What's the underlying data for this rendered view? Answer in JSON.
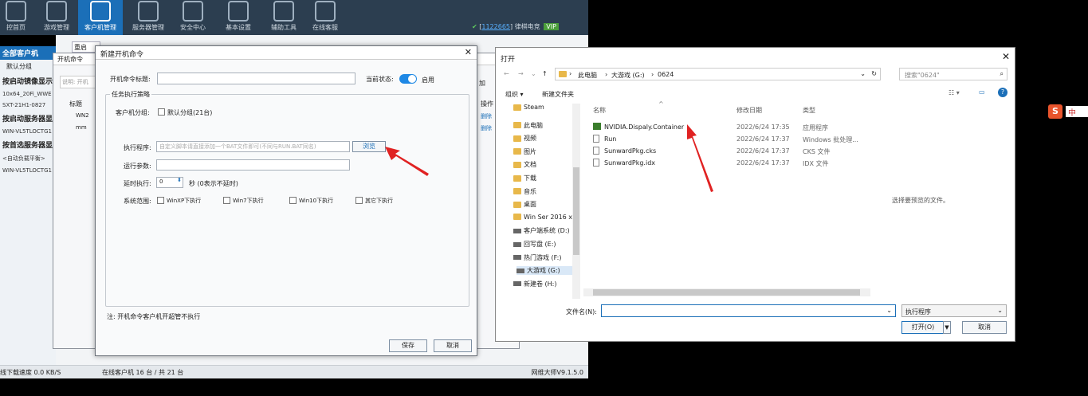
{
  "nav": {
    "items": [
      "控首页",
      "游戏管理",
      "客户机管理",
      "服务器管理",
      "安全中心",
      "基本设置",
      "辅助工具",
      "在线客服"
    ],
    "active_index": 2
  },
  "vip": {
    "id": "1122665",
    "name": "律棋电竞",
    "badge": "VIP"
  },
  "tree": {
    "header": "全部客户机",
    "items": [
      {
        "t": "默认分组",
        "k": "n"
      },
      {
        "t": "按启动镜像显示",
        "k": "b"
      },
      {
        "t": "10x64_20Fi_WWE",
        "k": "s"
      },
      {
        "t": "SXT-21H1-0827",
        "k": "s"
      },
      {
        "t": "按启动服务器显",
        "k": "b"
      },
      {
        "t": "WIN-VL5TLOCTG1",
        "k": "s"
      },
      {
        "t": "按首选服务器显",
        "k": "b"
      },
      {
        "t": "<自动负载平衡>",
        "k": "s"
      },
      {
        "t": "WIN-VL5TLOCTG1",
        "k": "s"
      }
    ]
  },
  "toolbar": {
    "restart": "重启"
  },
  "status": {
    "left": "线下载速度 0.0 KB/S",
    "mid": "在线客户机 16 台 / 共 21 台",
    "right": "网维大师V9.1.5.0"
  },
  "back_dialog": {
    "title": "开机命令",
    "hint": "说明: 开机",
    "col_title": "标题",
    "rows": [
      "WN2",
      "mm"
    ],
    "col_op": "操作",
    "op_delete": "删除",
    "add": "加"
  },
  "dialog": {
    "title": "新建开机命令",
    "title_label": "开机命令标题:",
    "state_label": "当前状态:",
    "state_value": "启用",
    "strategy": "任务执行策略",
    "group_label": "客户机分组:",
    "group_option": "默认分组(21台)",
    "program_label": "执行程序:",
    "program_placeholder": "自定义脚本请直接添加一个BAT文件即可(不同与RUN.BAT同名)",
    "browse": "浏览",
    "params_label": "运行参数:",
    "delay_label": "延时执行:",
    "delay_value": "0",
    "delay_unit": "秒 (0表示不延时)",
    "scope_label": "系统范围:",
    "scopes": [
      "WinXP下执行",
      "Win7下执行",
      "Win10下执行",
      "其它下执行"
    ],
    "note": "注: 开机命令客户机开超管不执行",
    "save": "保存",
    "cancel": "取消"
  },
  "file_dialog": {
    "title": "打开",
    "path": [
      "此电脑",
      "大游戏 (G:)",
      "0624"
    ],
    "search_placeholder": "搜索\"0624\"",
    "organize": "组织 ▾",
    "new_folder": "新建文件夹",
    "cols": [
      "名称",
      "修改日期",
      "类型"
    ],
    "files": [
      {
        "name": "NVIDIA.Dispaly.Container",
        "date": "2022/6/24 17:35",
        "type": "应用程序",
        "icon": "app"
      },
      {
        "name": "Run",
        "date": "2022/6/24 17:37",
        "type": "Windows 批处理...",
        "icon": "bat"
      },
      {
        "name": "SunwardPkg.cks",
        "date": "2022/6/24 17:37",
        "type": "CKS 文件",
        "icon": "file"
      },
      {
        "name": "SunwardPkg.idx",
        "date": "2022/6/24 17:37",
        "type": "IDX 文件",
        "icon": "file"
      }
    ],
    "nav": [
      "Steam",
      "此电脑",
      "视频",
      "图片",
      "文档",
      "下载",
      "音乐",
      "桌面",
      "Win Ser 2016 x",
      "客户端系统 (D:)",
      "回写盘 (E:)",
      "热门游戏 (F:)",
      "大游戏 (G:)",
      "新建卷 (H:)"
    ],
    "preview": "选择要预览的文件。",
    "filename_label": "文件名(N):",
    "filter": "执行程序",
    "open": "打开(O)",
    "cancel": "取消"
  },
  "ime": {
    "label": "中"
  }
}
